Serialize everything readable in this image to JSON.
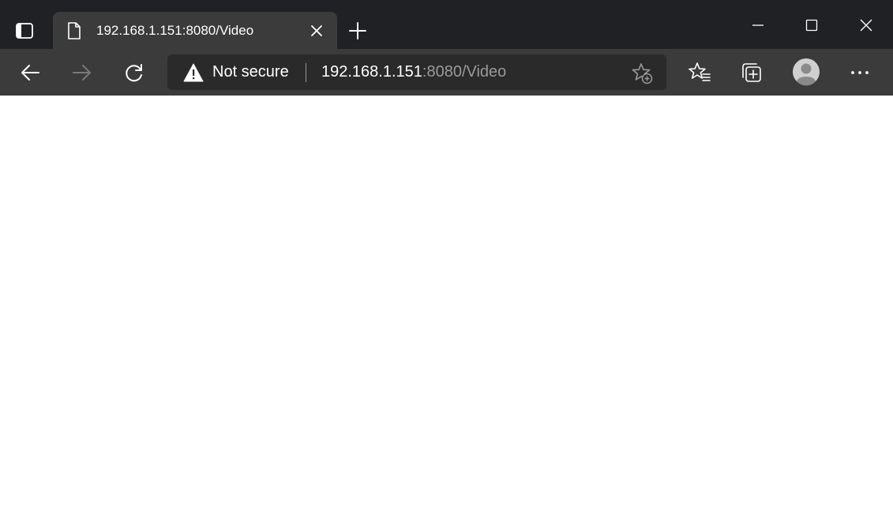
{
  "tab": {
    "title": "192.168.1.151:8080/Video"
  },
  "addressbar": {
    "security_label": "Not secure",
    "url_host": "192.168.1.151",
    "url_rest": ":8080/Video"
  },
  "icons": {
    "tab_actions": "tab-actions-icon",
    "page": "page-icon",
    "close_tab": "close-icon",
    "new_tab": "plus-icon",
    "minimize": "minimize-icon",
    "maximize": "maximize-icon",
    "close_window": "close-icon",
    "back": "arrow-left-icon",
    "forward": "arrow-right-icon",
    "refresh": "refresh-icon",
    "warning": "warning-icon",
    "add_favorite": "star-plus-icon",
    "favorites": "star-list-icon",
    "collections": "collections-icon",
    "profile": "avatar-icon",
    "more": "more-icon"
  },
  "colors": {
    "titlebar": "#202124",
    "toolbar": "#3b3b3b",
    "addressbar": "#2a2a2a",
    "text": "#ffffff",
    "muted_text": "#9a9a9a",
    "page_background": "#ffffff"
  }
}
